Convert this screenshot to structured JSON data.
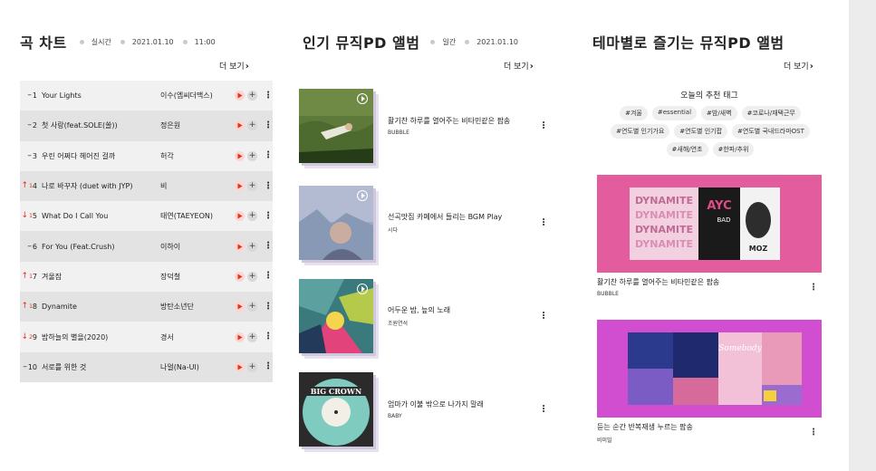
{
  "chart": {
    "title": "곡 차트",
    "mode": "실시간",
    "date": "2021.01.10",
    "time": "11:00",
    "more_label": "더 보기",
    "rows": [
      {
        "rank": "1",
        "trend": "same",
        "change": "",
        "song": "Your Lights",
        "artist": "이수(엠씨더맥스)"
      },
      {
        "rank": "2",
        "trend": "same",
        "change": "",
        "song": "첫 사랑(feat.SOLE(쏠))",
        "artist": "정은원"
      },
      {
        "rank": "3",
        "trend": "same",
        "change": "",
        "song": "우린 어쩌다 헤어진 걸까",
        "artist": "허각"
      },
      {
        "rank": "4",
        "trend": "up",
        "change": "1",
        "song": "나로 바꾸자 (duet with JYP)",
        "artist": "비"
      },
      {
        "rank": "5",
        "trend": "down",
        "change": "1",
        "song": "What Do I Call You",
        "artist": "태연(TAEYEON)"
      },
      {
        "rank": "6",
        "trend": "same",
        "change": "",
        "song": "For You (Feat.Crush)",
        "artist": "이하이"
      },
      {
        "rank": "7",
        "trend": "up",
        "change": "1",
        "song": "겨울잠",
        "artist": "장덕철"
      },
      {
        "rank": "8",
        "trend": "up",
        "change": "1",
        "song": "Dynamite",
        "artist": "방탄소년단"
      },
      {
        "rank": "9",
        "trend": "down",
        "change": "2",
        "song": "밤하늘의 별을(2020)",
        "artist": "경서"
      },
      {
        "rank": "10",
        "trend": "same",
        "change": "",
        "song": "서로를 위한 것",
        "artist": "나얼(Na-Ul)"
      }
    ]
  },
  "popular": {
    "title": "인기 뮤직PD 앨범",
    "mode": "일간",
    "date": "2021.01.10",
    "more_label": "더 보기",
    "albums": [
      {
        "title": "활기찬 하루를 열어주는 비타민같은 팝송",
        "curator": "BUBBLE",
        "cover": "grass"
      },
      {
        "title": "선곡맛집 카페에서 들리는 BGM Play",
        "curator": "시다",
        "cover": "portrait"
      },
      {
        "title": "어두운 밤, 늪의 노래",
        "curator": "조원연석",
        "cover": "art"
      },
      {
        "title": "엄마가 이불 밖으로 나가지 말래",
        "curator": "BABY",
        "cover": "vinyl"
      }
    ],
    "vinyl_label": "BIG CROWN"
  },
  "theme": {
    "title": "테마별로 즐기는 뮤직PD 앨범",
    "more_label": "더 보기",
    "tags_title": "오늘의 추천 태그",
    "tags": [
      "#겨울",
      "#essential",
      "#밤/새벽",
      "#코로나/재택근무",
      "#연도별 인기가요",
      "#연도별 인기팝",
      "#연도별 국내드라마OST",
      "#새해/연초",
      "#한파/추위"
    ],
    "cards": [
      {
        "title": "활기찬 하루를 열어주는 비타민같은 팝송",
        "curator": "BUBBLE",
        "bg": "#e35d9e",
        "banner_text": [
          "DYNAMITE",
          "AYC",
          "BAD",
          "MOZ"
        ]
      },
      {
        "title": "듣는 순간 반복재생 누르는 팝송",
        "curator": "비미밀",
        "bg": "#d04ecf",
        "banner_text": [
          "Somebody"
        ]
      }
    ]
  },
  "colors": {
    "accent": "#e0321d",
    "row_light": "#f1f1f1",
    "row_dark": "#e3e3e3"
  }
}
